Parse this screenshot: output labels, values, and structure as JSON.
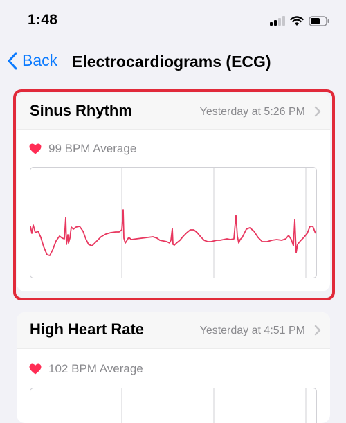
{
  "status_bar": {
    "time": "1:48",
    "icons": [
      "signal-icon",
      "wifi-icon",
      "battery-icon"
    ]
  },
  "nav": {
    "back_label": "Back",
    "title": "Electrocardiograms (ECG)"
  },
  "recordings": [
    {
      "classification": "Sinus Rhythm",
      "date": "Yesterday at 5:26 PM",
      "average": "99 BPM Average",
      "selected": true
    },
    {
      "classification": "High Heart Rate",
      "date": "Yesterday at 4:51 PM",
      "average": "102 BPM Average",
      "selected": false
    }
  ],
  "colors": {
    "accent": "#0a7aff",
    "heart": "#ff2d55",
    "waveform": "#e8375f",
    "highlight": "#e12a3a"
  }
}
